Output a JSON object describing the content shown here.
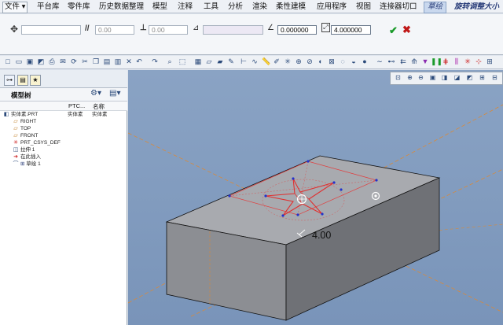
{
  "menu": {
    "file": "文件",
    "items": [
      "平台库",
      "零件库",
      "历史数据整理",
      "模型",
      "注释",
      "工具",
      "分析",
      "渲染",
      "柔性建模",
      "应用程序",
      "视图",
      "连接器切口"
    ],
    "active_tab": "草绘",
    "extra_tab": "旋转调整大小"
  },
  "dashboard": {
    "field1_value": "",
    "field2_value": "0.00",
    "field3_value": "0.00",
    "field4_value": "",
    "angle_value": "0.000000",
    "scale_value": "4.000000"
  },
  "tree": {
    "header_label": "模型树",
    "col_ptc": "PTC...",
    "col_name": "名称",
    "root": "实体素.PRT",
    "root_col1": "实体素",
    "root_col2": "实体素",
    "nodes": [
      "RIGHT",
      "TOP",
      "FRONT",
      "PRT_CSYS_DEF",
      "拉伸 1",
      "在此插入",
      "草绘 1"
    ]
  },
  "graphics": {
    "dimension_label": "4.00"
  },
  "colors": {
    "accent": "#2a3e7a",
    "sketch_red": "#e03030",
    "sketch_blue": "#2233cc",
    "datum_orange": "#e08a2a",
    "ok_green": "#1a9a2a",
    "cancel_red": "#c01818"
  }
}
